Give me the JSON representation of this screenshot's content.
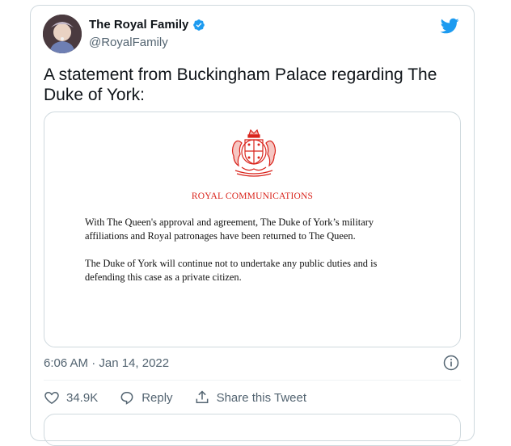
{
  "account": {
    "display_name": "The Royal Family",
    "handle": "@RoyalFamily",
    "verified": true
  },
  "tweet": {
    "text": "A statement from Buckingham Palace regarding The Duke of York:",
    "timestamp": "6:06 AM · Jan 14, 2022"
  },
  "statement_image": {
    "heading": "ROYAL COMMUNICATIONS",
    "paragraph_1": "With The Queen's approval and agreement, The Duke of York’s military affiliations and Royal patronages have been returned to The Queen.",
    "paragraph_2": "The Duke of York will continue not to undertake any public duties and is defending this case as a private citizen."
  },
  "actions": {
    "like_count": "34.9K",
    "reply_label": "Reply",
    "share_label": "Share this Tweet"
  },
  "icons": [
    "twitter-bird-icon",
    "verified-badge-icon",
    "info-icon",
    "heart-icon",
    "reply-icon",
    "share-icon",
    "royal-crest-icon"
  ],
  "colors": {
    "twitter_blue": "#1d9bf0",
    "heading_red": "#d9241c",
    "secondary_text": "#536471",
    "border": "#cfd9de"
  }
}
